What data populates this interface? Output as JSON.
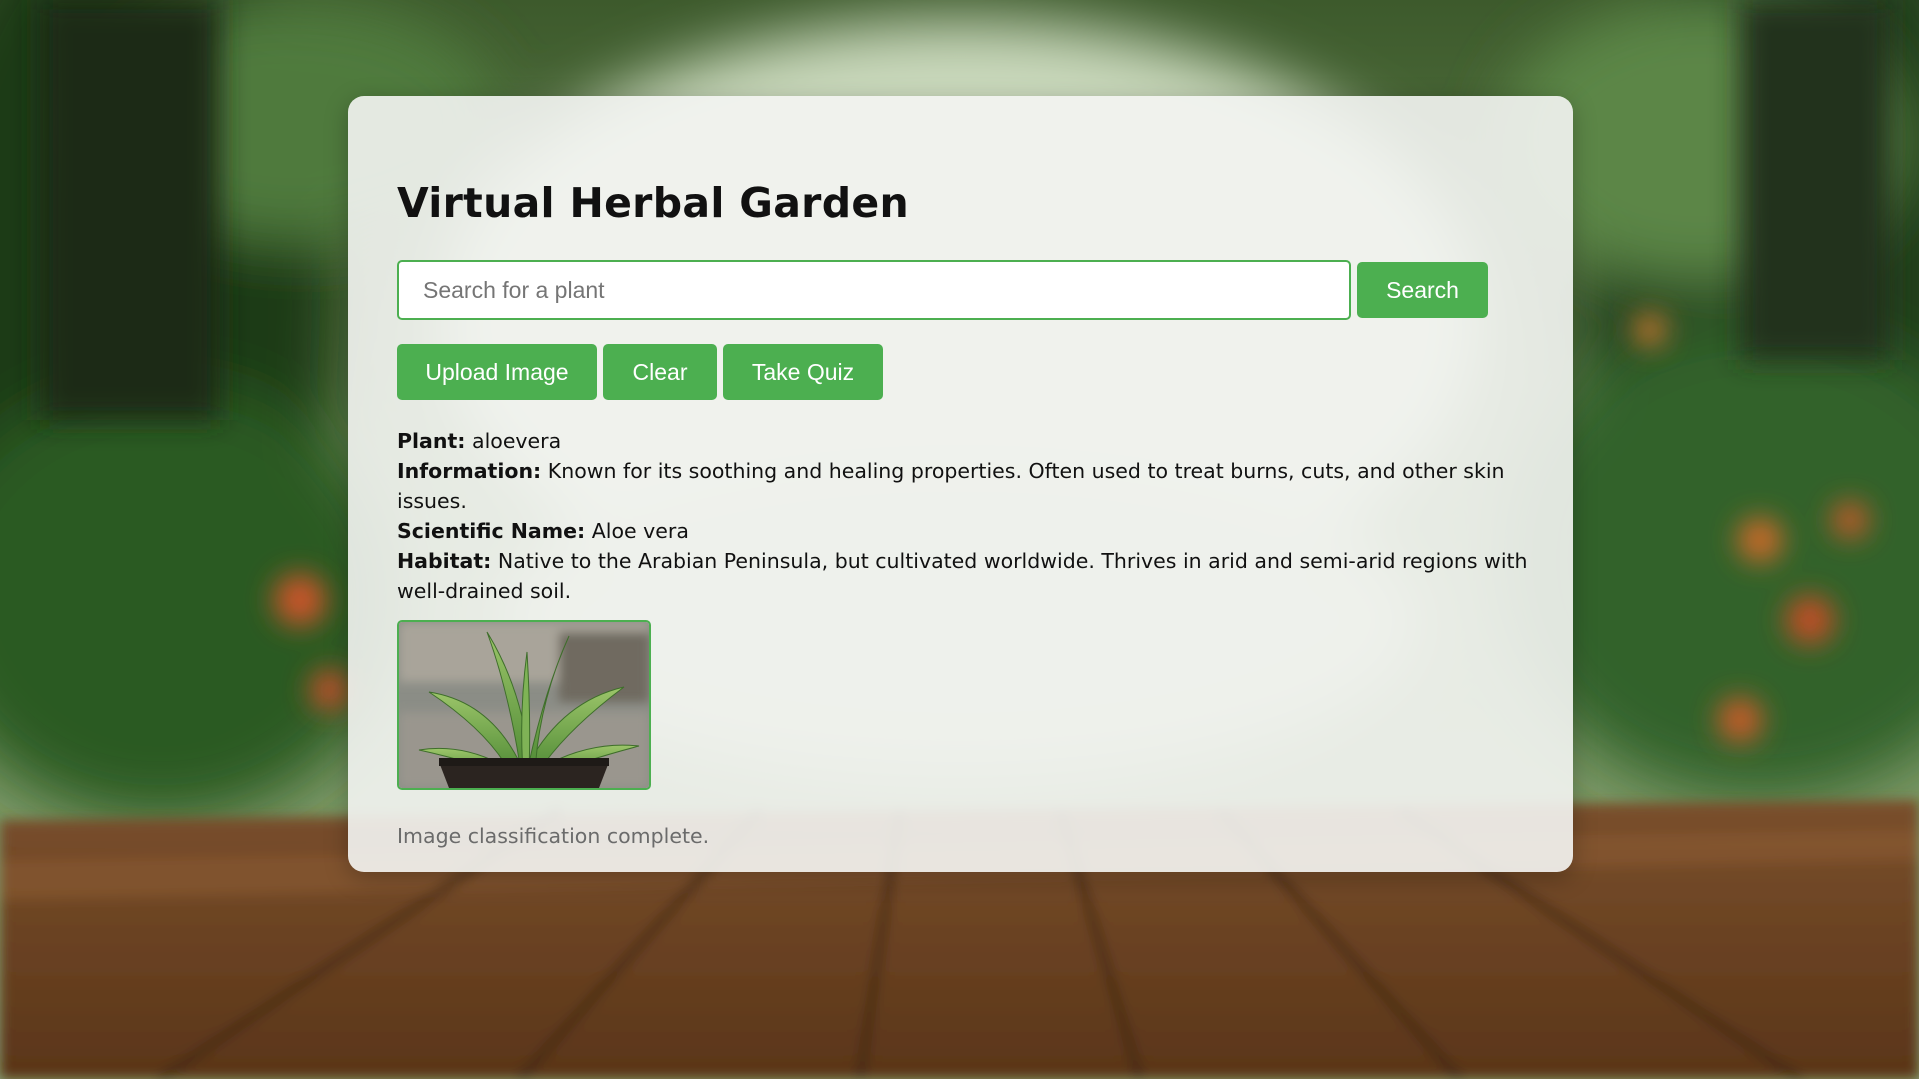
{
  "app": {
    "title": "Virtual Herbal Garden"
  },
  "search": {
    "placeholder": "Search for a plant",
    "value": "",
    "button_label": "Search"
  },
  "actions": {
    "upload_label": "Upload Image",
    "clear_label": "Clear",
    "quiz_label": "Take Quiz"
  },
  "result": {
    "plant_label": "Plant:",
    "plant_value": "aloevera",
    "information_label": "Information:",
    "information_value": "Known for its soothing and healing properties. Often used to treat burns, cuts, and other skin issues.",
    "scientific_label": "Scientific Name:",
    "scientific_value": "Aloe vera",
    "habitat_label": "Habitat:",
    "habitat_value": "Native to the Arabian Peninsula, but cultivated worldwide. Thrives in arid and semi-arid regions with well-drained soil."
  },
  "status": {
    "message": "Image classification complete."
  },
  "colors": {
    "accent": "#4caf50",
    "card_background": "#f4f5f3",
    "text": "#111111",
    "muted_text": "#6b6b6b"
  },
  "icons": {
    "plant_photo": "aloe-vera-photo"
  }
}
